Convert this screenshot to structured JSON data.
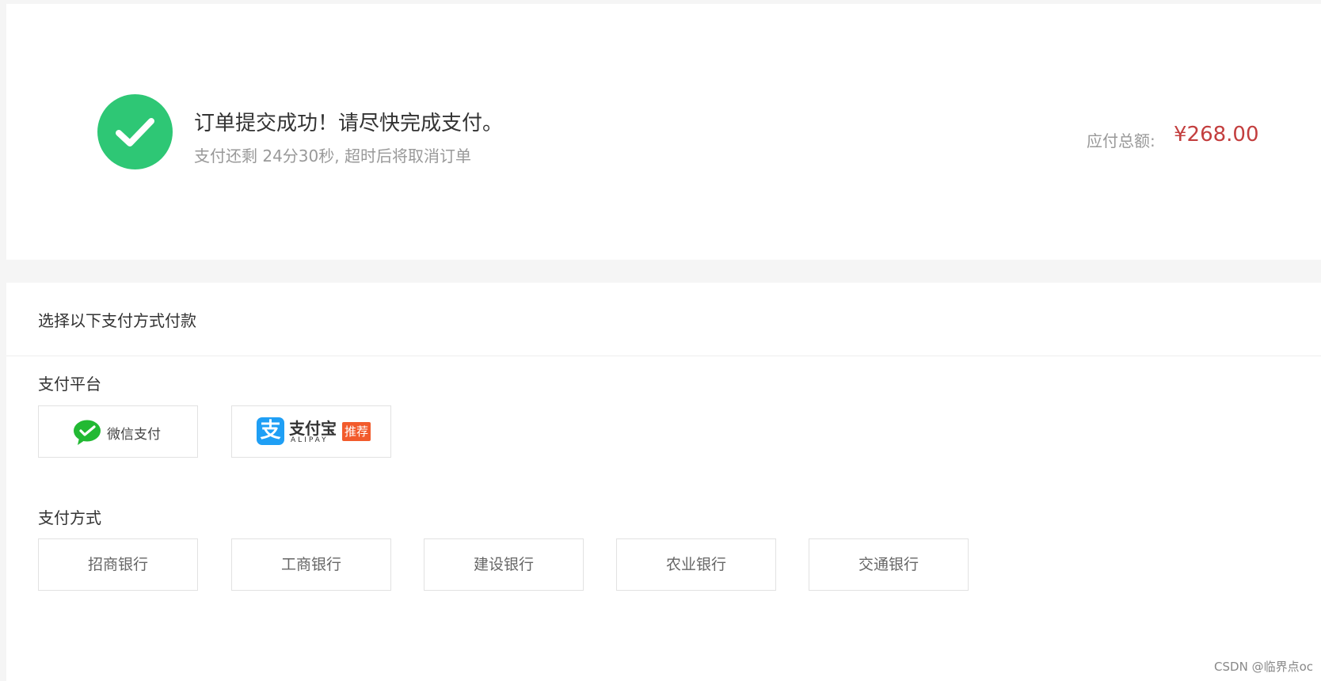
{
  "order": {
    "title": "订单提交成功！请尽快完成支付。",
    "countdown": "支付还剩 24分30秒, 超时后将取消订单",
    "total_label": "应付总额:",
    "total_amount": "¥268.00"
  },
  "payment": {
    "title": "选择以下支付方式付款",
    "platform_label": "支付平台",
    "platforms": {
      "wechat": {
        "label": "微信支付",
        "color": "#22b933"
      },
      "alipay": {
        "name": "支付宝",
        "name_en": "ALIPAY",
        "badge": "推荐",
        "icon_char": "支",
        "color": "#1f9ff5"
      }
    },
    "method_label": "支付方式",
    "banks": [
      "招商银行",
      "工商银行",
      "建设银行",
      "农业银行",
      "交通银行"
    ]
  },
  "watermark": "CSDN @临界点oc",
  "colors": {
    "success": "#2ec775",
    "price": "#c33e3e",
    "badge": "#f25b2c"
  }
}
